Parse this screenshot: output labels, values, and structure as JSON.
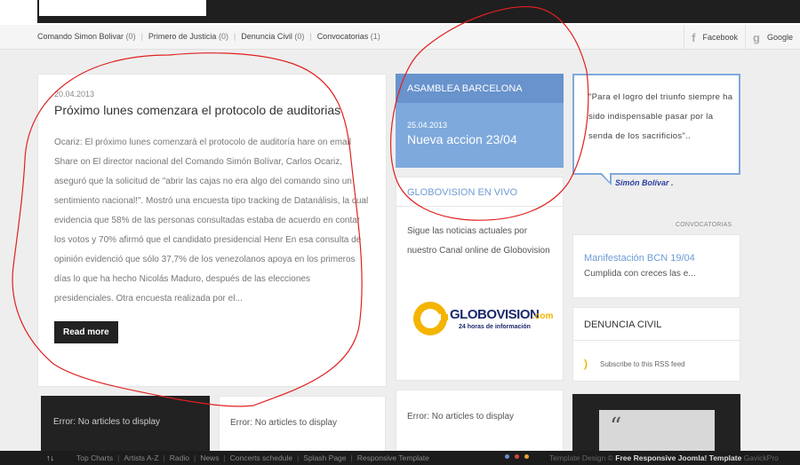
{
  "nav": {
    "categories": [
      {
        "label": "Comando Simon Bolivar",
        "count": "(0)"
      },
      {
        "label": "Primero de Justicia",
        "count": "(0)"
      },
      {
        "label": "Denuncia Civil",
        "count": "(0)"
      },
      {
        "label": "Convocatorias",
        "count": "(1)"
      }
    ],
    "social": [
      {
        "icon": "facebook-icon",
        "glyph": "f",
        "label": "Facebook"
      },
      {
        "icon": "google-icon",
        "glyph": "g",
        "label": "Google"
      }
    ]
  },
  "article": {
    "date": "20.04.2013",
    "title": "Próximo lunes comenzara el protocolo de auditorias",
    "body": "Ocariz: El próximo lunes comenzará el protocolo de auditoría hare on email Share on El director nacional del Comando Simón Bolívar, Carlos Ocariz, aseguró que la solicitud de \"abrir las cajas no era algo del comando sino un sentimiento nacional!\". Mostró una encuesta tipo tracking de Datanálisis, la cual evidencia que 58% de las personas consultadas estaba de acuerdo en contar los votos y 70% afirmó que el candidato presidencial Henr En esa consulta de opinión evidenció que sólo 37,7% de los venezolanos apoya en los primeros días lo que ha hecho Nicolás Maduro, después de las elecciones presidenciales. Otra encuesta realizada por el...",
    "read_more": "Read more"
  },
  "asamblea": {
    "heading": "ASAMBLEA BARCELONA",
    "date": "25.04.2013",
    "title": "Nueva accion 23/04"
  },
  "globovision": {
    "heading": "GLOBOVISION EN VIVO",
    "text": "Sigue las noticias actuales por nuestro Canal online  de Globovision",
    "logo_text": "GLOBOVISION",
    "logo_suffix": ".com",
    "logo_tagline": "24 horas de información"
  },
  "quote": {
    "text": "\"Para el logro del triunfo siempre ha sido indispensable pasar por la senda de los sacrificios\"..",
    "author": "Simón Bolívar ."
  },
  "convocatorias": {
    "label": "CONVOCATORIAS",
    "title": "Manifestación BCN 19/04",
    "summary": "Cumplida con creces las e..."
  },
  "denuncia": {
    "heading": "DENUNCIA CIVIL",
    "rss_label": "Subscribe to this RSS feed"
  },
  "errors": {
    "no_articles": "Error: No articles to display"
  },
  "footer": {
    "links": [
      "Top Charts",
      "Artists A-Z",
      "Radio",
      "News",
      "Concerts schedule",
      "Splash Page",
      "Responsive Template"
    ],
    "dot_colors": [
      "#6a8fd0",
      "#d04a3a",
      "#e7a53a"
    ],
    "credit_prefix": "Template Design © ",
    "credit_bold": "Free Responsive Joomla! Template",
    "credit_suffix": " GavickPro"
  },
  "colors": {
    "accent_blue": "#7ea9dc",
    "annotation_red": "#e02020"
  }
}
